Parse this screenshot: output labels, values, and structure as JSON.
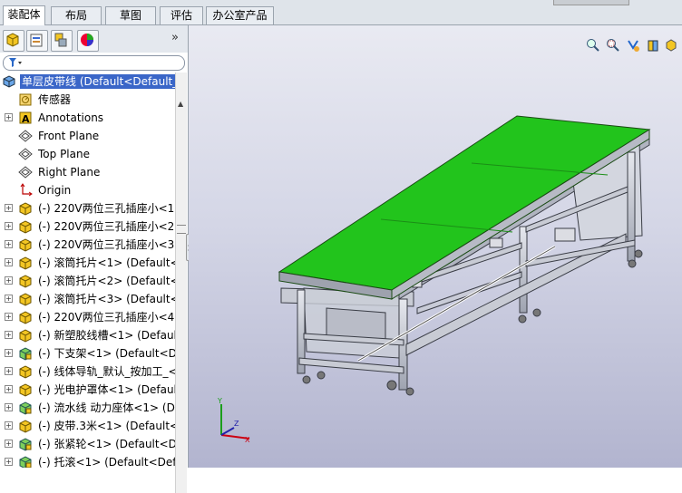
{
  "command_tabs": [
    {
      "label": "装配体",
      "active": true
    },
    {
      "label": "布局",
      "active": false
    },
    {
      "label": "草图",
      "active": false
    },
    {
      "label": "评估",
      "active": false
    },
    {
      "label": "办公室产品",
      "active": false
    }
  ],
  "panel_tabs": [
    "feature-manager-icon",
    "property-manager-icon",
    "configuration-manager-icon",
    "display-manager-icon"
  ],
  "expand_arrows": "»",
  "tree": {
    "root": "单层皮带线  (Default<Default_",
    "items": [
      {
        "label": "传感器",
        "icon": "sensor-icon",
        "expander": false
      },
      {
        "label": "Annotations",
        "icon": "annotations-icon",
        "expander": true
      },
      {
        "label": "Front Plane",
        "icon": "plane-icon",
        "expander": false
      },
      {
        "label": "Top Plane",
        "icon": "plane-icon",
        "expander": false
      },
      {
        "label": "Right Plane",
        "icon": "plane-icon",
        "expander": false
      },
      {
        "label": "Origin",
        "icon": "origin-icon",
        "expander": false
      },
      {
        "label": "(-) 220V两位三孔插座小<1",
        "icon": "part-icon",
        "expander": true
      },
      {
        "label": "(-) 220V两位三孔插座小<2",
        "icon": "part-icon",
        "expander": true
      },
      {
        "label": "(-) 220V两位三孔插座小<3",
        "icon": "part-icon",
        "expander": true
      },
      {
        "label": "(-) 滚筒托片<1> (Default<",
        "icon": "part-icon",
        "expander": true
      },
      {
        "label": "(-) 滚筒托片<2> (Default<",
        "icon": "part-icon",
        "expander": true
      },
      {
        "label": "(-) 滚筒托片<3> (Default<",
        "icon": "part-icon",
        "expander": true
      },
      {
        "label": "(-) 220V两位三孔插座小<4",
        "icon": "part-icon",
        "expander": true
      },
      {
        "label": "(-) 新塑胶线槽<1> (Defaul",
        "icon": "part-icon",
        "expander": true
      },
      {
        "label": "(-) 下支架<1> (Default<De",
        "icon": "assembly-icon",
        "expander": true
      },
      {
        "label": "(-) 线体导轨_默认_按加工_<",
        "icon": "part-icon",
        "expander": true
      },
      {
        "label": "(-) 光电护罩体<1> (Defaul",
        "icon": "part-icon",
        "expander": true
      },
      {
        "label": "(-) 流水线 动力座体<1> (D",
        "icon": "assembly-icon",
        "expander": true
      },
      {
        "label": "(-) 皮带.3米<1> (Default<",
        "icon": "part-icon",
        "expander": true
      },
      {
        "label": "(-) 张紧轮<1> (Default<De",
        "icon": "assembly-icon",
        "expander": true
      },
      {
        "label": "(-) 托滚<1> (Default<Defa",
        "icon": "assembly-icon",
        "expander": true
      }
    ]
  },
  "view_toolbar": [
    "zoom-to-fit-icon",
    "zoom-area-icon",
    "previous-view-icon",
    "section-view-icon",
    "view-orientation-icon",
    "display-style-icon"
  ],
  "colors": {
    "belt": "#22c41c",
    "frame": "#c8cbd4",
    "selection": "#3a66c8"
  }
}
